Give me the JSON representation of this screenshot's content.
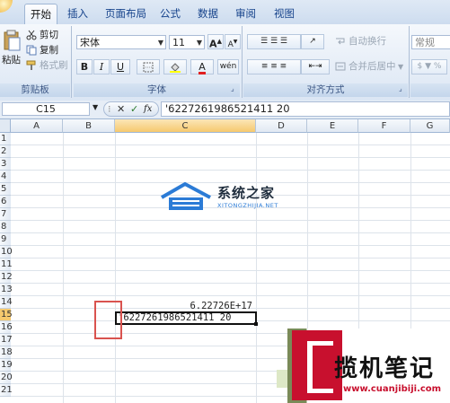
{
  "tabs": [
    "开始",
    "插入",
    "页面布局",
    "公式",
    "数据",
    "审阅",
    "视图"
  ],
  "clipboard": {
    "paste": "粘贴",
    "cut": "剪切",
    "copy": "复制",
    "format_painter": "格式刷",
    "label": "剪贴板"
  },
  "font": {
    "name": "宋体",
    "size": "11",
    "grow": "A",
    "shrink": "A",
    "bold": "B",
    "italic": "I",
    "underline": "U",
    "color_letter": "A",
    "phonetic": "wén",
    "label": "字体"
  },
  "alignment": {
    "wrap": "自动换行",
    "merge": "合并后居中",
    "label": "对齐方式"
  },
  "number": {
    "format": "常规"
  },
  "formula_bar": {
    "name_box": "C15",
    "fx": "fx",
    "value": "'6227261986521411 20"
  },
  "columns": [
    "A",
    "B",
    "C",
    "D",
    "E",
    "F",
    "G"
  ],
  "rows": [
    "1",
    "2",
    "3",
    "4",
    "5",
    "6",
    "7",
    "8",
    "9",
    "10",
    "11",
    "12",
    "13",
    "14",
    "15",
    "16",
    "17",
    "18",
    "19",
    "20",
    "21"
  ],
  "cells": {
    "c14": "6.22726E+17",
    "c15": "'6227261986521411 20"
  },
  "watermark1": {
    "title": "系统之家",
    "url": "XITONGZHIJIA.NET"
  },
  "watermark2": {
    "title": "揽机笔记",
    "url": "www.cuanjibiji.com"
  },
  "colors": {
    "accent": "#15428b",
    "highlight": "#d9534f",
    "selected_header": "#f6c96e"
  }
}
